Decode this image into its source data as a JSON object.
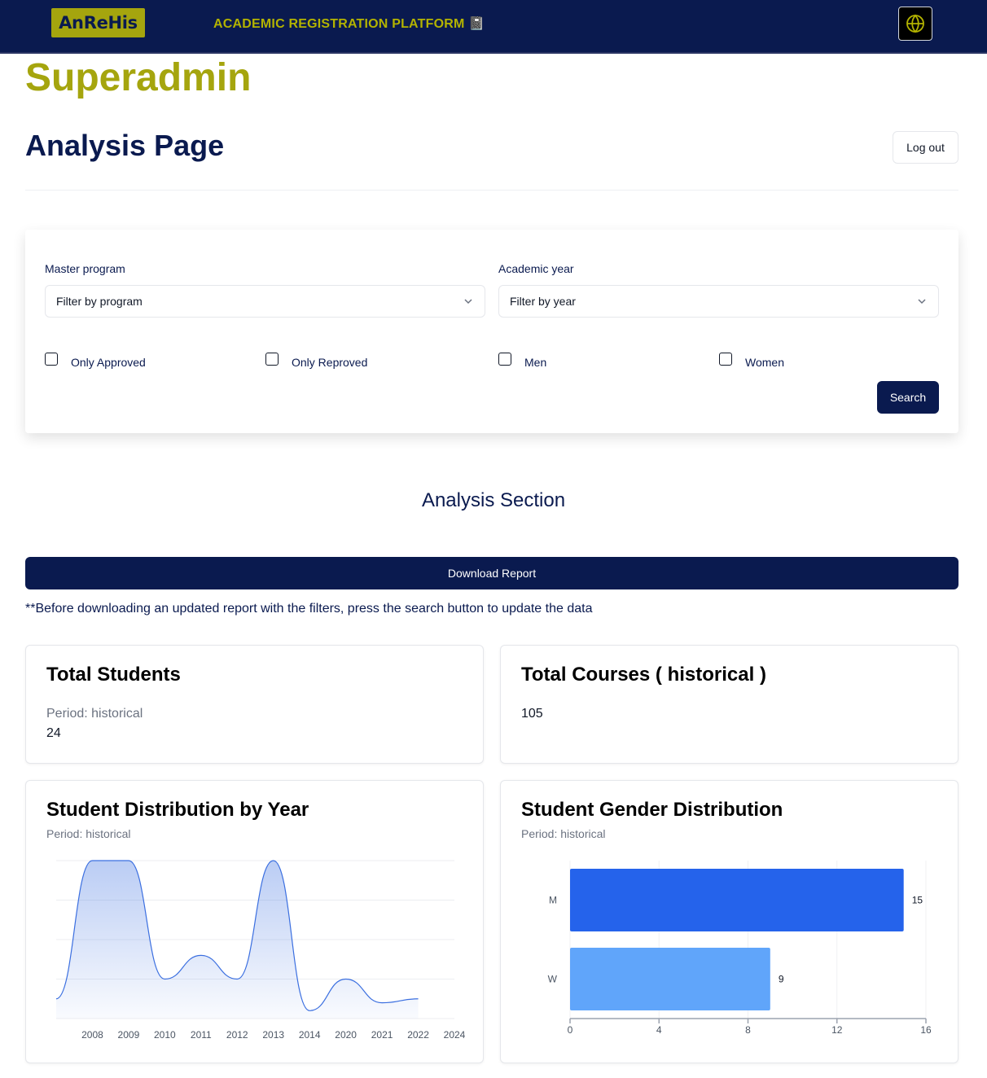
{
  "header": {
    "logo": "AnReHis",
    "platform_title": "ACADEMIC REGISTRATION PLATFORM 📓",
    "language_icon": "globe-icon"
  },
  "user_role": "Superadmin",
  "page_title": "Analysis Page",
  "logout_label": "Log out",
  "filters": {
    "program_label": "Master program",
    "program_value": "Filter by program",
    "year_label": "Academic year",
    "year_value": "Filter by year",
    "checkboxes": [
      {
        "label": "Only Approved",
        "checked": false
      },
      {
        "label": "Only Reproved",
        "checked": false
      },
      {
        "label": "Men",
        "checked": false
      },
      {
        "label": "Women",
        "checked": false
      }
    ],
    "search_label": "Search"
  },
  "analysis": {
    "section_title": "Analysis Section",
    "download_label": "Download Report",
    "note": "**Before downloading an updated report with the filters, press the search button to update the data"
  },
  "stats": {
    "students": {
      "title": "Total Students",
      "period": "Period: historical",
      "value": "24"
    },
    "courses": {
      "title": "Total Courses ( historical )",
      "value": "105"
    }
  },
  "charts": {
    "year_title": "Student Distribution by Year",
    "year_period": "Period: historical",
    "gender_title": "Student Gender Distribution",
    "gender_period": "Period: historical"
  },
  "colors": {
    "navy": "#0a1a4f",
    "olive": "#a5a50e",
    "area_stroke": "#3b6fe0",
    "bar_m": "#2563eb",
    "bar_w": "#60a5fa"
  },
  "chart_data": [
    {
      "type": "area",
      "title": "Student Distribution by Year",
      "categories": [
        "2008",
        "2009",
        "2010",
        "2011",
        "2012",
        "2013",
        "2014",
        "2020",
        "2021",
        "2022",
        "2024"
      ],
      "values": [
        4,
        4,
        1,
        1.6,
        1,
        4,
        0.2,
        1,
        0.4,
        0.5
      ],
      "start_value": 0.5,
      "ylim": [
        0,
        4
      ],
      "grid": true
    },
    {
      "type": "bar",
      "orientation": "horizontal",
      "title": "Student Gender Distribution",
      "categories": [
        "M",
        "W"
      ],
      "values": [
        15,
        9
      ],
      "xlim": [
        0,
        16
      ],
      "xticks": [
        0,
        4,
        8,
        12,
        16
      ],
      "grid": true
    }
  ]
}
